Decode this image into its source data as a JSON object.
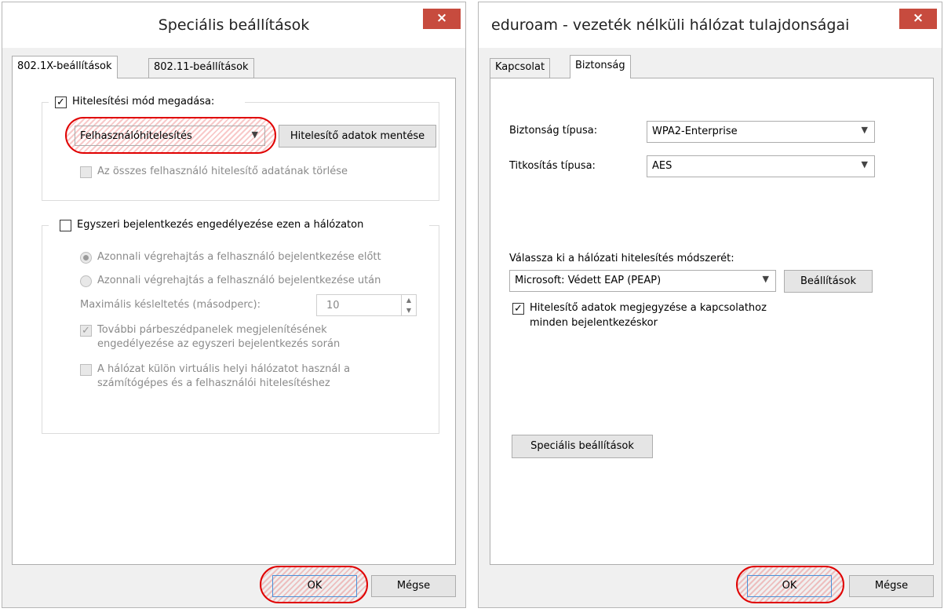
{
  "left_dialog": {
    "title": "Speciális beállítások",
    "close": "×",
    "tabs": [
      "802.1X-beállítások",
      "802.11-beállítások"
    ],
    "auth_mode": {
      "checkbox_label": "Hitelesítési mód megadása:",
      "checked": true,
      "select_value": "Felhasználóhitelesítés",
      "save_button": "Hitelesítő adatok mentése",
      "delete_label": "Az összes felhasználó hitelesítő adatának törlése"
    },
    "sso": {
      "checkbox_label": "Egyszeri bejelentkezés engedélyezése ezen a hálózaton",
      "radio1": "Azonnali végrehajtás a felhasználó bejelentkezése előtt",
      "radio2": "Azonnali végrehajtás a felhasználó bejelentkezése után",
      "delay_label": "Maximális késleltetés (másodperc):",
      "delay_value": "10",
      "extra1_line1": "További párbeszédpanelek megjelenítésének",
      "extra1_line2": "engedélyezése az egyszeri bejelentkezés során",
      "extra2_line1": "A hálózat külön virtuális helyi hálózatot használ a",
      "extra2_line2": "számítógépes és a felhasználói hitelesítéshez"
    },
    "ok": "OK",
    "cancel": "Mégse"
  },
  "right_dialog": {
    "title": "eduroam - vezeték nélküli hálózat tulajdonságai",
    "close": "×",
    "tabs": [
      "Kapcsolat",
      "Biztonság"
    ],
    "security_type_label": "Biztonság típusa:",
    "security_type_value": "WPA2-Enterprise",
    "encryption_label": "Titkosítás típusa:",
    "encryption_value": "AES",
    "method_label": "Válassza ki a hálózati hitelesítés módszerét:",
    "method_value": "Microsoft: Védett EAP (PEAP)",
    "settings_button": "Beállítások",
    "remember_line1": "Hitelesítő adatok megjegyzése a kapcsolathoz",
    "remember_line2": "minden bejelentkezéskor",
    "advanced_button": "Speciális beállítások",
    "ok": "OK",
    "cancel": "Mégse"
  },
  "colors": {
    "close_red": "#c74b3e",
    "highlight": "#e00000"
  }
}
